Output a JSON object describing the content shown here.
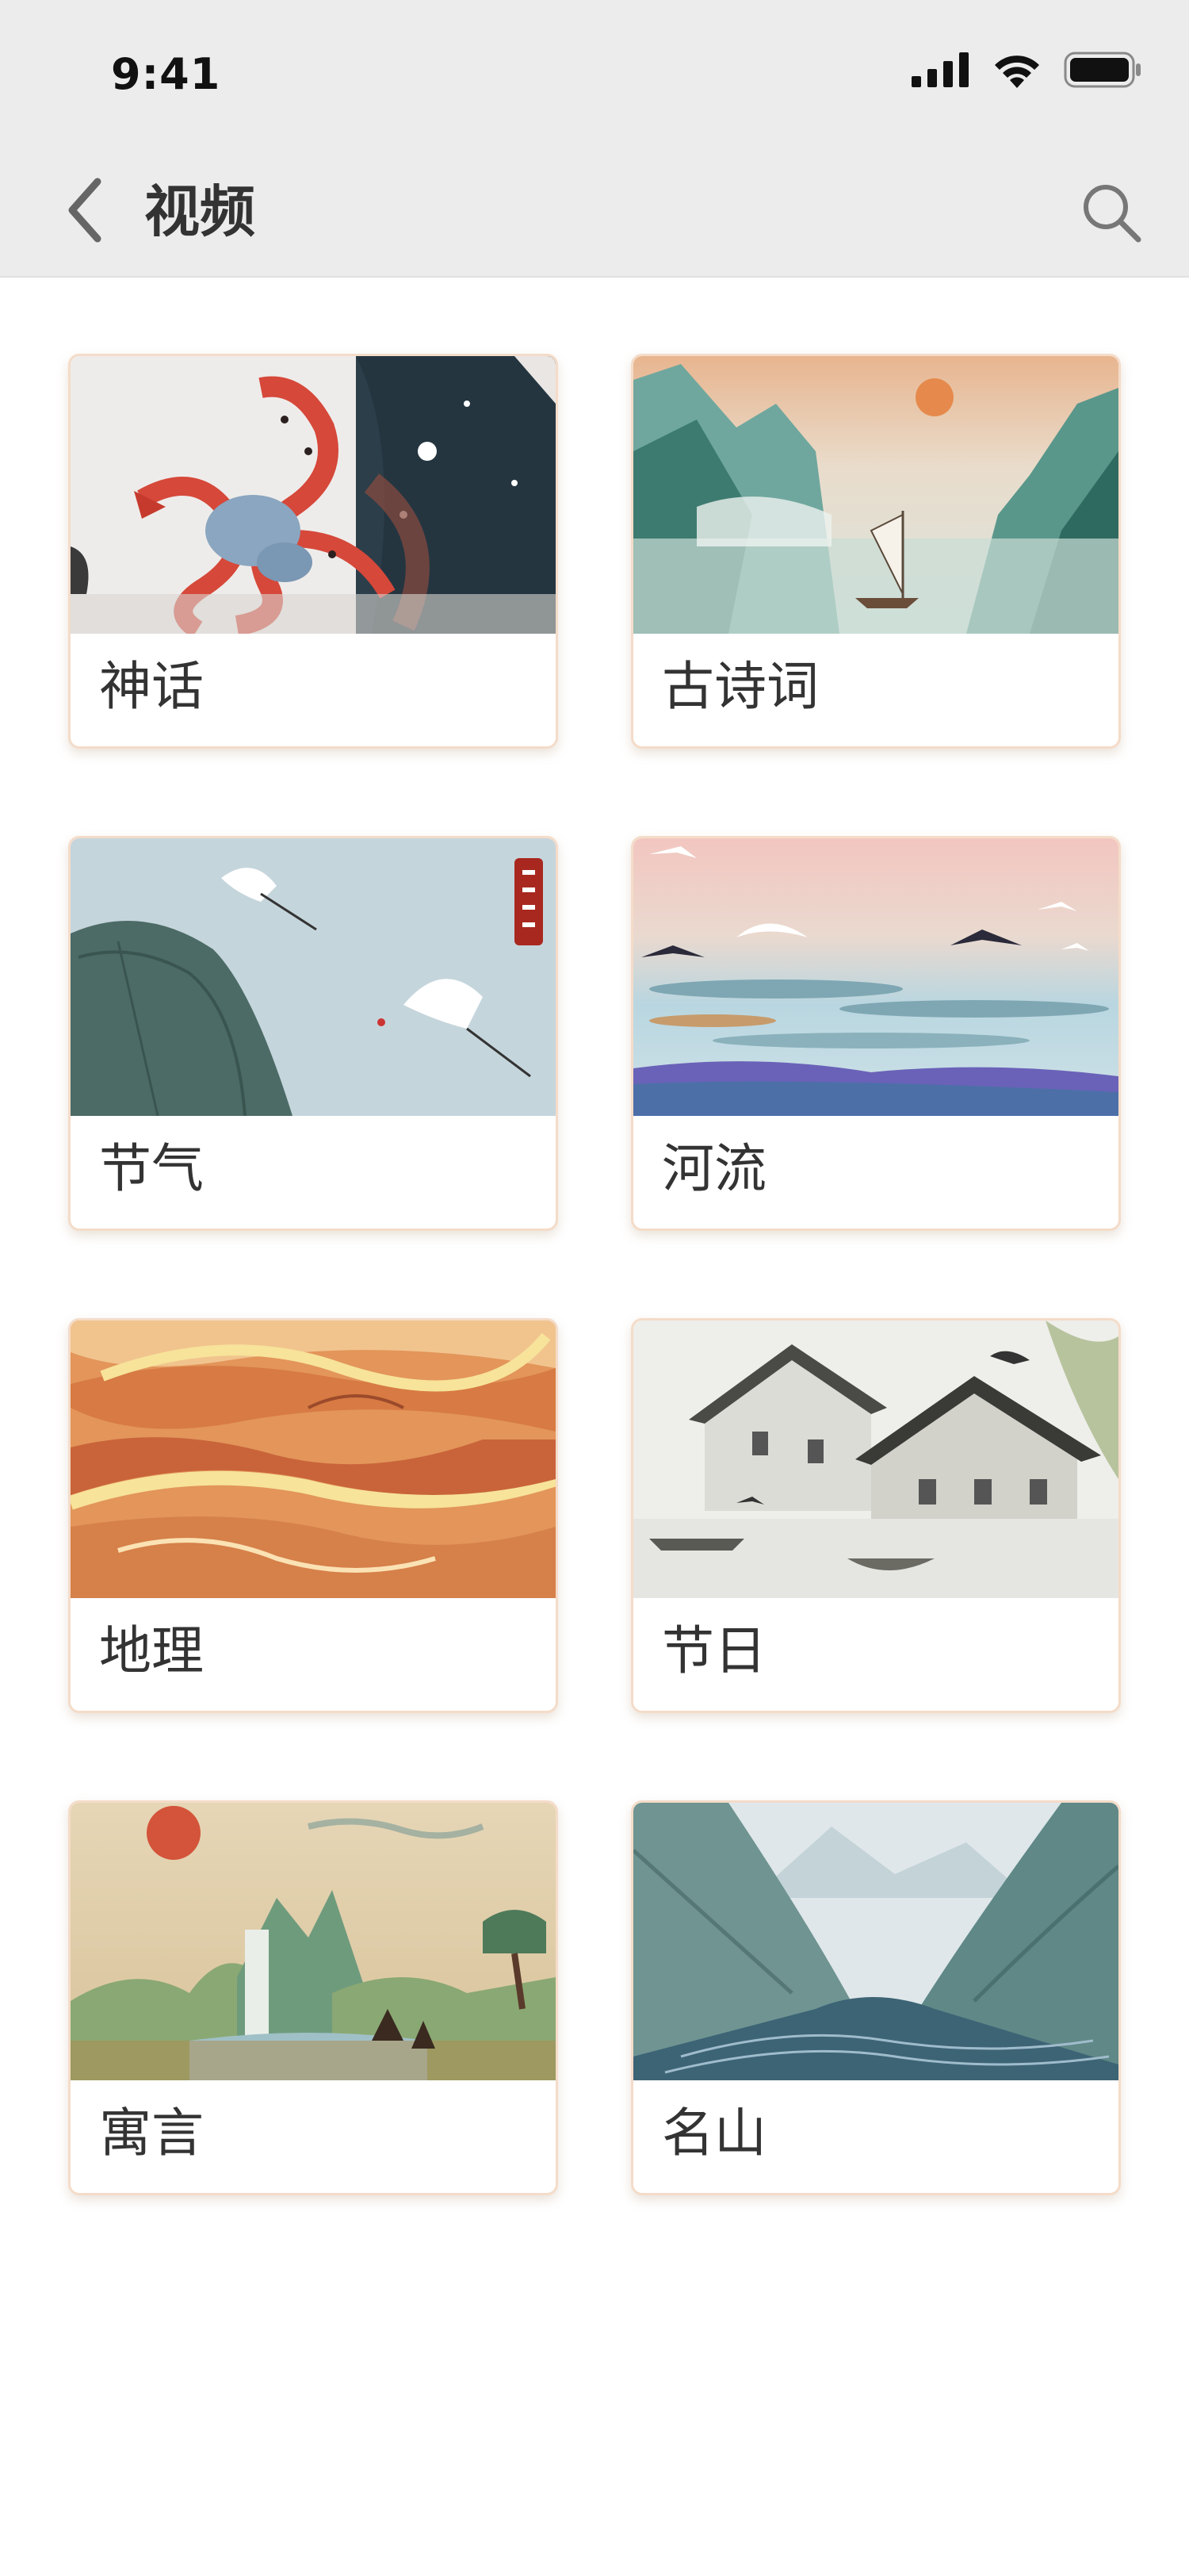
{
  "status": {
    "time": "9:41"
  },
  "header": {
    "title": "视频",
    "back_icon": "chevron-left-icon",
    "search_icon": "search-icon"
  },
  "categories": [
    {
      "label": "神话",
      "image": "snake-mythology-illustration"
    },
    {
      "label": "古诗词",
      "image": "mountain-lake-sailboat-painting"
    },
    {
      "label": "节气",
      "image": "cranes-lotus-leaf-painting"
    },
    {
      "label": "河流",
      "image": "swallows-over-river-painting"
    },
    {
      "label": "地理",
      "image": "winding-river-landscape-painting"
    },
    {
      "label": "节日",
      "image": "water-town-ink-painting"
    },
    {
      "label": "寓言",
      "image": "waterfall-sun-landscape-painting"
    },
    {
      "label": "名山",
      "image": "valley-mountains-river-painting"
    }
  ],
  "colors": {
    "header_bg": "#ececec",
    "card_border": "#f4dcc9",
    "text": "#333333"
  }
}
